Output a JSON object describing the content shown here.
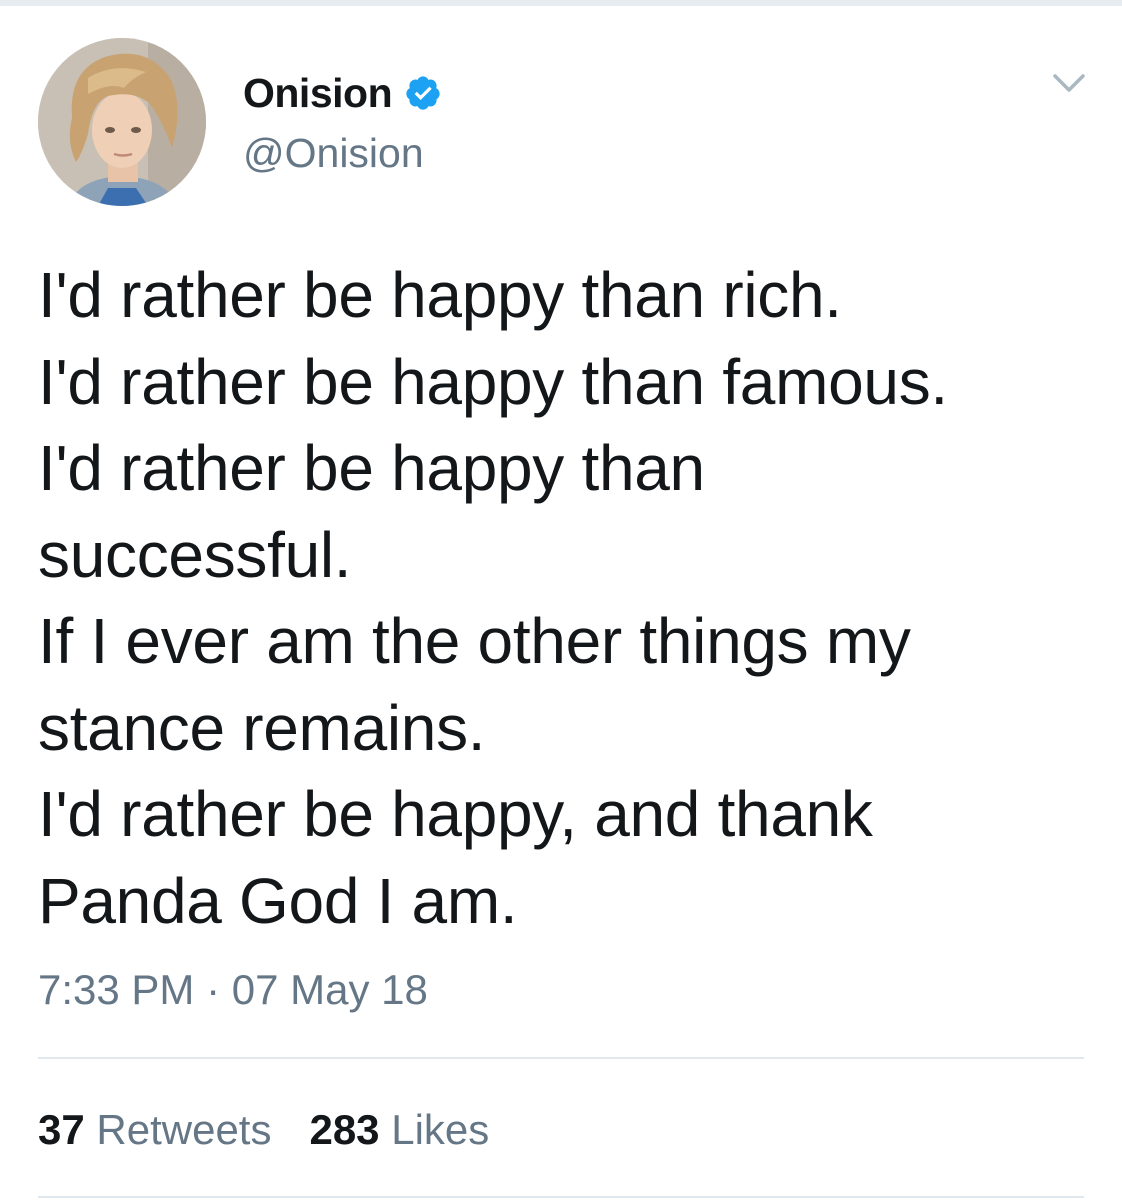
{
  "tweet": {
    "author": {
      "display_name": "Onision",
      "handle": "@Onision",
      "verified": true
    },
    "text_lines": [
      "I'd rather be happy than rich.",
      "I'd rather be happy than famous.",
      "I'd rather be happy than",
      "successful.",
      "If I ever am the other things my",
      "stance remains.",
      "I'd rather be happy, and thank",
      "Panda God I am."
    ],
    "time": "7:33 PM",
    "separator": "·",
    "date": "07 May 18",
    "stats": {
      "retweets_count": "37",
      "retweets_label": "Retweets",
      "likes_count": "283",
      "likes_label": "Likes"
    }
  },
  "icons": {
    "verified": "verified-badge-icon",
    "menu": "chevron-down-icon"
  },
  "colors": {
    "text_primary": "#14171a",
    "text_secondary": "#657786",
    "verified_blue": "#1da1f2",
    "divider": "#e1e8ed"
  }
}
